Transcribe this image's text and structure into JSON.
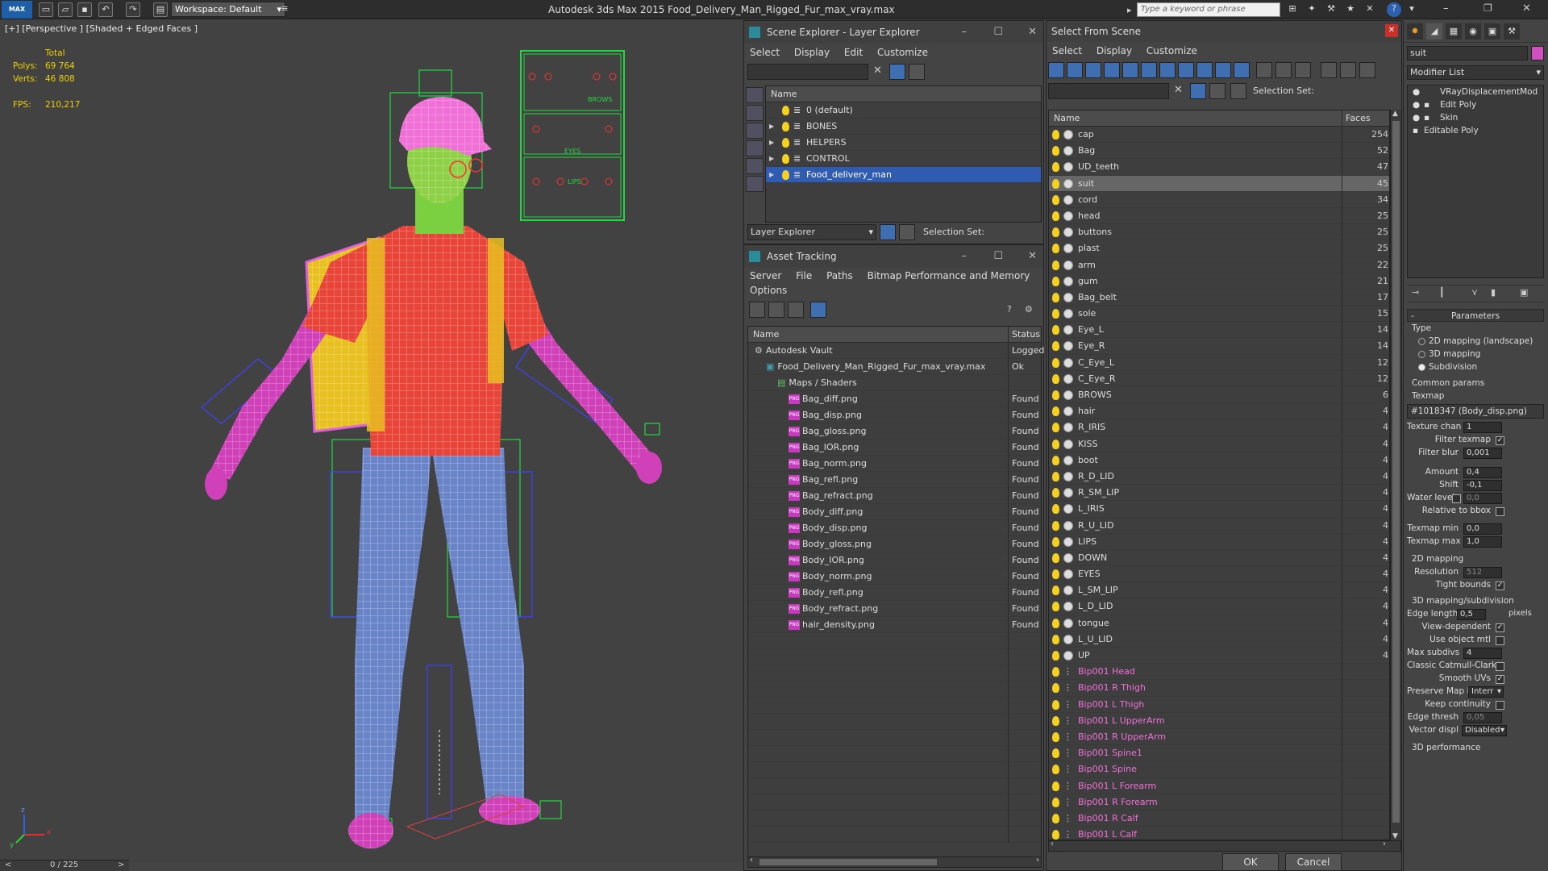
{
  "app": {
    "title": "Autodesk 3ds Max  2015    Food_Delivery_Man_Rigged_Fur_max_vray.max",
    "logo": "MAX",
    "workspace": "Workspace: Default",
    "search_placeholder": "Type a keyword or phrase"
  },
  "viewport": {
    "label": "[+] [Perspective ] [Shaded + Edged Faces ]",
    "stats": {
      "total_label": "Total",
      "polys_label": "Polys:",
      "polys_value": "69 764",
      "verts_label": "Verts:",
      "verts_value": "46 808",
      "fps_label": "FPS:",
      "fps_value": "210,217"
    },
    "board_labels": [
      "BROWS",
      "EYES",
      "LIPS"
    ],
    "axis": [
      "x",
      "y",
      "z"
    ],
    "timeline": {
      "frame": "0 / 225",
      "prev": "<",
      "next": ">"
    }
  },
  "scene_explorer": {
    "title": "Scene Explorer - Layer Explorer",
    "menu": [
      "Select",
      "Display",
      "Edit",
      "Customize"
    ],
    "column": "Name",
    "layers": [
      {
        "name": "0 (default)",
        "expand": "",
        "selected": false
      },
      {
        "name": "BONES",
        "expand": "▶",
        "selected": false
      },
      {
        "name": "HELPERS",
        "expand": "▶",
        "selected": false
      },
      {
        "name": "CONTROL",
        "expand": "▶",
        "selected": false
      },
      {
        "name": "Food_delivery_man",
        "expand": "▶",
        "selected": true
      }
    ],
    "footer_dropdown": "Layer Explorer",
    "footer_selection": "Selection Set:"
  },
  "asset_tracking": {
    "title": "Asset Tracking",
    "menu": [
      "Server",
      "File",
      "Paths",
      "Bitmap Performance and Memory"
    ],
    "menu2": "Options",
    "columns": {
      "name": "Name",
      "status": "Status"
    },
    "rows": [
      {
        "name": "Autodesk Vault",
        "status": "Logged",
        "indent": 0,
        "icon": "vault"
      },
      {
        "name": "Food_Delivery_Man_Rigged_Fur_max_vray.max",
        "status": "Ok",
        "indent": 1,
        "icon": "max"
      },
      {
        "name": "Maps / Shaders",
        "status": "",
        "indent": 2,
        "icon": "folder"
      },
      {
        "name": "Bag_diff.png",
        "status": "Found",
        "indent": 3,
        "icon": "png"
      },
      {
        "name": "Bag_disp.png",
        "status": "Found",
        "indent": 3,
        "icon": "png"
      },
      {
        "name": "Bag_gloss.png",
        "status": "Found",
        "indent": 3,
        "icon": "png"
      },
      {
        "name": "Bag_IOR.png",
        "status": "Found",
        "indent": 3,
        "icon": "png"
      },
      {
        "name": "Bag_norm.png",
        "status": "Found",
        "indent": 3,
        "icon": "png"
      },
      {
        "name": "Bag_refl.png",
        "status": "Found",
        "indent": 3,
        "icon": "png"
      },
      {
        "name": "Bag_refract.png",
        "status": "Found",
        "indent": 3,
        "icon": "png"
      },
      {
        "name": "Body_diff.png",
        "status": "Found",
        "indent": 3,
        "icon": "png"
      },
      {
        "name": "Body_disp.png",
        "status": "Found",
        "indent": 3,
        "icon": "png"
      },
      {
        "name": "Body_gloss.png",
        "status": "Found",
        "indent": 3,
        "icon": "png"
      },
      {
        "name": "Body_IOR.png",
        "status": "Found",
        "indent": 3,
        "icon": "png"
      },
      {
        "name": "Body_norm.png",
        "status": "Found",
        "indent": 3,
        "icon": "png"
      },
      {
        "name": "Body_refl.png",
        "status": "Found",
        "indent": 3,
        "icon": "png"
      },
      {
        "name": "Body_refract.png",
        "status": "Found",
        "indent": 3,
        "icon": "png"
      },
      {
        "name": "hair_density.png",
        "status": "Found",
        "indent": 3,
        "icon": "png"
      }
    ]
  },
  "select_from_scene": {
    "title": "Select From Scene",
    "menu": [
      "Select",
      "Display",
      "Customize"
    ],
    "selection_set": "Selection Set:",
    "columns": {
      "name": "Name",
      "faces": "Faces"
    },
    "objects": [
      {
        "name": "cap",
        "faces": "254",
        "bone": false,
        "selected": false
      },
      {
        "name": "Bag",
        "faces": "52",
        "bone": false,
        "selected": false
      },
      {
        "name": "UD_teeth",
        "faces": "47",
        "bone": false,
        "selected": false
      },
      {
        "name": "suit",
        "faces": "45",
        "bone": false,
        "selected": true
      },
      {
        "name": "cord",
        "faces": "34",
        "bone": false,
        "selected": false
      },
      {
        "name": "head",
        "faces": "25",
        "bone": false,
        "selected": false
      },
      {
        "name": "buttons",
        "faces": "25",
        "bone": false,
        "selected": false
      },
      {
        "name": "plast",
        "faces": "25",
        "bone": false,
        "selected": false
      },
      {
        "name": "arm",
        "faces": "22",
        "bone": false,
        "selected": false
      },
      {
        "name": "gum",
        "faces": "21",
        "bone": false,
        "selected": false
      },
      {
        "name": "Bag_belt",
        "faces": "17",
        "bone": false,
        "selected": false
      },
      {
        "name": "sole",
        "faces": "15",
        "bone": false,
        "selected": false
      },
      {
        "name": "Eye_L",
        "faces": "14",
        "bone": false,
        "selected": false
      },
      {
        "name": "Eye_R",
        "faces": "14",
        "bone": false,
        "selected": false
      },
      {
        "name": "C_Eye_L",
        "faces": "12",
        "bone": false,
        "selected": false
      },
      {
        "name": "C_Eye_R",
        "faces": "12",
        "bone": false,
        "selected": false
      },
      {
        "name": "BROWS",
        "faces": "6",
        "bone": false,
        "selected": false
      },
      {
        "name": "hair",
        "faces": "4",
        "bone": false,
        "selected": false
      },
      {
        "name": "R_IRIS",
        "faces": "4",
        "bone": false,
        "selected": false
      },
      {
        "name": "KISS",
        "faces": "4",
        "bone": false,
        "selected": false
      },
      {
        "name": "boot",
        "faces": "4",
        "bone": false,
        "selected": false
      },
      {
        "name": "R_D_LID",
        "faces": "4",
        "bone": false,
        "selected": false
      },
      {
        "name": "R_SM_LIP",
        "faces": "4",
        "bone": false,
        "selected": false
      },
      {
        "name": "L_IRIS",
        "faces": "4",
        "bone": false,
        "selected": false
      },
      {
        "name": "R_U_LID",
        "faces": "4",
        "bone": false,
        "selected": false
      },
      {
        "name": "LIPS",
        "faces": "4",
        "bone": false,
        "selected": false
      },
      {
        "name": "DOWN",
        "faces": "4",
        "bone": false,
        "selected": false
      },
      {
        "name": "EYES",
        "faces": "4",
        "bone": false,
        "selected": false
      },
      {
        "name": "L_SM_LIP",
        "faces": "4",
        "bone": false,
        "selected": false
      },
      {
        "name": "L_D_LID",
        "faces": "4",
        "bone": false,
        "selected": false
      },
      {
        "name": "tongue",
        "faces": "4",
        "bone": false,
        "selected": false
      },
      {
        "name": "L_U_LID",
        "faces": "4",
        "bone": false,
        "selected": false
      },
      {
        "name": "UP",
        "faces": "4",
        "bone": false,
        "selected": false
      },
      {
        "name": "Bip001 Head",
        "faces": "",
        "bone": true,
        "selected": false
      },
      {
        "name": "Bip001 R Thigh",
        "faces": "",
        "bone": true,
        "selected": false
      },
      {
        "name": "Bip001 L Thigh",
        "faces": "",
        "bone": true,
        "selected": false
      },
      {
        "name": "Bip001 L UpperArm",
        "faces": "",
        "bone": true,
        "selected": false
      },
      {
        "name": "Bip001 R UpperArm",
        "faces": "",
        "bone": true,
        "selected": false
      },
      {
        "name": "Bip001 Spine1",
        "faces": "",
        "bone": true,
        "selected": false
      },
      {
        "name": "Bip001 Spine",
        "faces": "",
        "bone": true,
        "selected": false
      },
      {
        "name": "Bip001 L Forearm",
        "faces": "",
        "bone": true,
        "selected": false
      },
      {
        "name": "Bip001 R Forearm",
        "faces": "",
        "bone": true,
        "selected": false
      },
      {
        "name": "Bip001 R Calf",
        "faces": "",
        "bone": true,
        "selected": false
      },
      {
        "name": "Bip001 L Calf",
        "faces": "",
        "bone": true,
        "selected": false
      }
    ],
    "ok": "OK",
    "cancel": "Cancel"
  },
  "command_panel": {
    "object_name": "suit",
    "modifier_list": "Modifier List",
    "stack": [
      "VRayDisplacementMod",
      "Edit Poly",
      "Skin",
      "Editable Poly"
    ],
    "rollout_title": "Parameters",
    "type_label": "Type",
    "type_options": [
      "2D mapping (landscape)",
      "3D mapping",
      "Subdivision"
    ],
    "type_selected": 2,
    "common_params": "Common params",
    "texmap_label": "Texmap",
    "texmap_value": "#1018347 (Body_disp.png)",
    "texture_chan_label": "Texture chan",
    "texture_chan_value": "1",
    "filter_texmap_label": "Filter texmap",
    "filter_blur_label": "Filter blur",
    "filter_blur_value": "0,001",
    "amount_label": "Amount",
    "amount_value": "0,4",
    "shift_label": "Shift",
    "shift_value": "-0,1",
    "water_level_label": "Water level",
    "water_level_value": "0,0",
    "relative_bbox_label": "Relative to bbox",
    "texmap_min_label": "Texmap min",
    "texmap_min_value": "0,0",
    "texmap_max_label": "Texmap max",
    "texmap_max_value": "1,0",
    "mapping2d": "2D mapping",
    "resolution_label": "Resolution",
    "resolution_value": "512",
    "tight_bounds_label": "Tight bounds",
    "mapping3d": "3D mapping/subdivision",
    "edge_length_label": "Edge length",
    "edge_length_value": "0,5",
    "pixels_label": "pixels",
    "view_dependent_label": "View-dependent",
    "use_object_mtl_label": "Use object mtl",
    "max_subdivs_label": "Max subdivs",
    "max_subdivs_value": "4",
    "catmull_label": "Classic Catmull-Clark",
    "smooth_uvs_label": "Smooth UVs",
    "preserve_map_label": "Preserve Map Bnd",
    "preserve_map_value": "Interr",
    "keep_continuity_label": "Keep continuity",
    "edge_thresh_label": "Edge thresh",
    "edge_thresh_value": "0,05",
    "vector_displ_label": "Vector displ",
    "vector_displ_value": "Disabled",
    "perf_label": "3D performance"
  }
}
